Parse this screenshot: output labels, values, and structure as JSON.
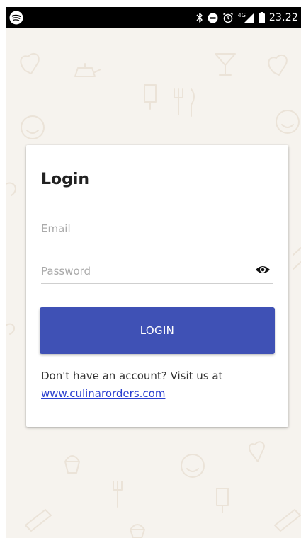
{
  "status_bar": {
    "network": "4G",
    "time": "23.22",
    "icons": [
      "spotify-icon",
      "bluetooth-icon",
      "do-not-disturb-icon",
      "alarm-icon",
      "signal-icon",
      "battery-icon"
    ]
  },
  "login_card": {
    "title": "Login",
    "email_placeholder": "Email",
    "email_value": "",
    "password_placeholder": "Password",
    "password_value": "",
    "login_button_label": "LOGIN",
    "footer_text": "Don't have an account? Visit us at",
    "footer_link": "www.culinarorders.com"
  },
  "colors": {
    "primary": "#3f51b5",
    "background": "#f6f3ee",
    "link": "#2a3fcf"
  }
}
